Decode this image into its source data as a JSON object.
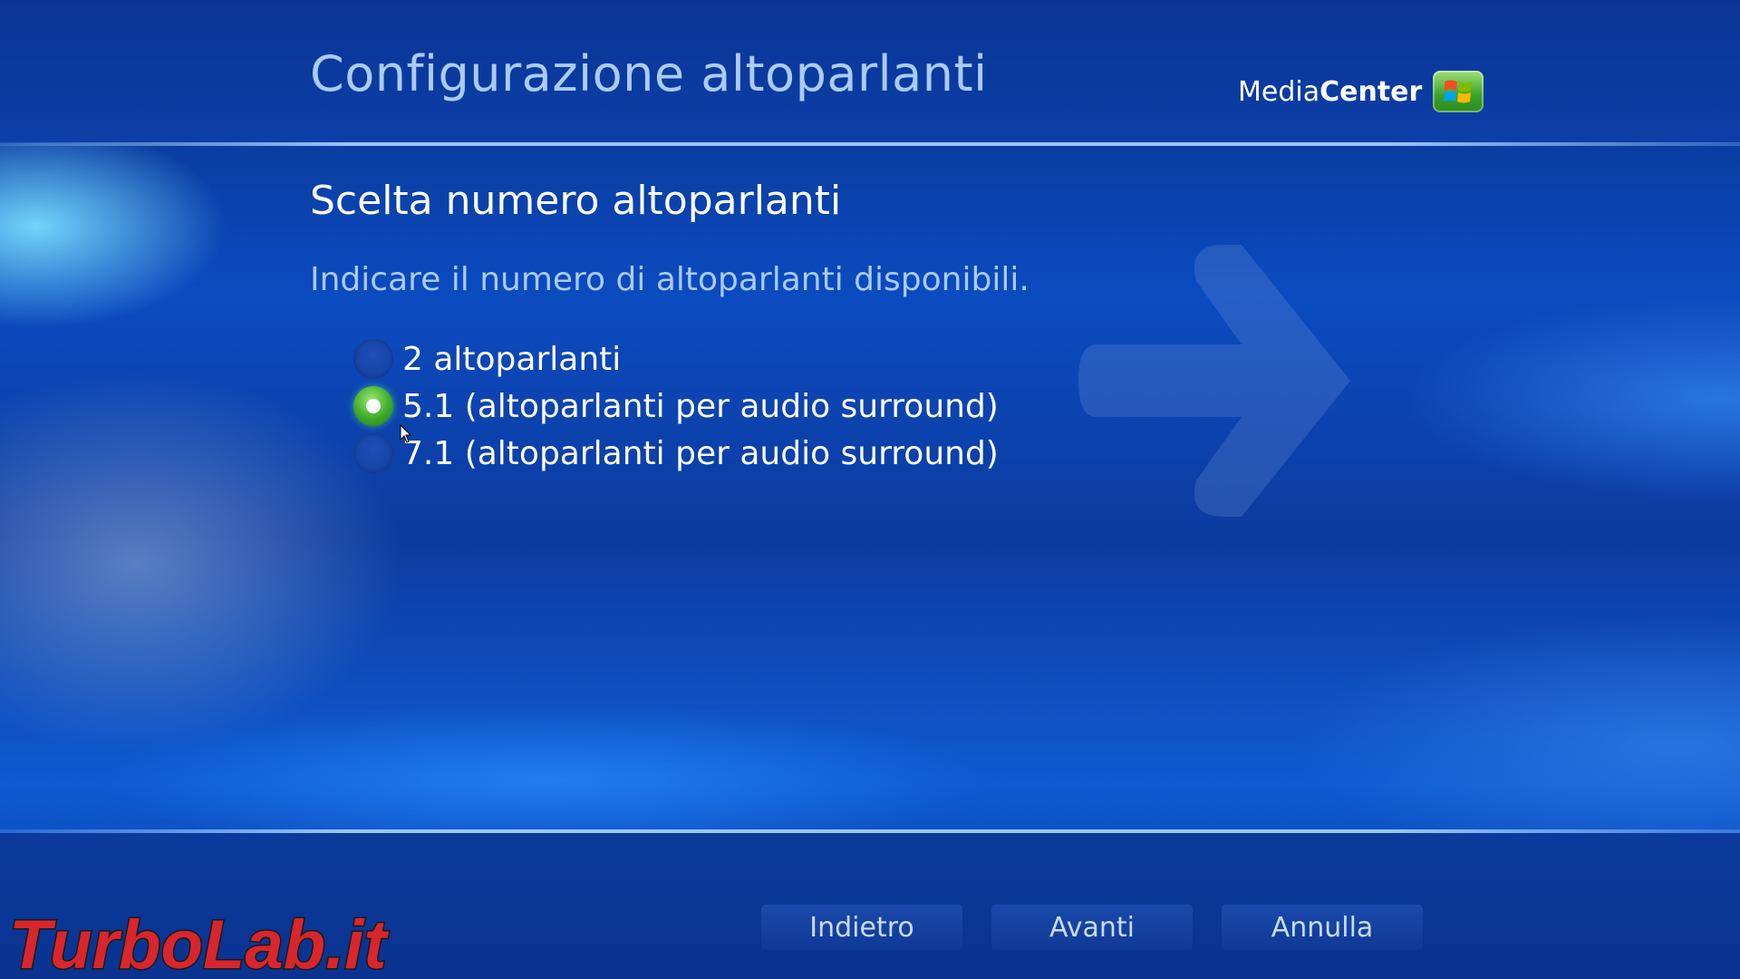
{
  "header": {
    "title": "Configurazione altoparlanti",
    "logo": {
      "light": "Media",
      "bold": "Center",
      "icon": "windows-flag-icon"
    }
  },
  "main": {
    "section_title": "Scelta numero altoparlanti",
    "instruction": "Indicare il numero di altoparlanti disponibili.",
    "options": [
      {
        "label": "2 altoparlanti",
        "selected": false
      },
      {
        "label": "5.1 (altoparlanti per audio surround)",
        "selected": true
      },
      {
        "label": "7.1 (altoparlanti per audio surround)",
        "selected": false
      }
    ],
    "background_icon": "arrow-right-icon"
  },
  "footer": {
    "back_label": "Indietro",
    "next_label": "Avanti",
    "cancel_label": "Annulla",
    "watermark": "TurboLab.it"
  },
  "colors": {
    "accent": "#a9cbf5",
    "selected": "#3caa2a",
    "background": "#0a3fa8"
  }
}
